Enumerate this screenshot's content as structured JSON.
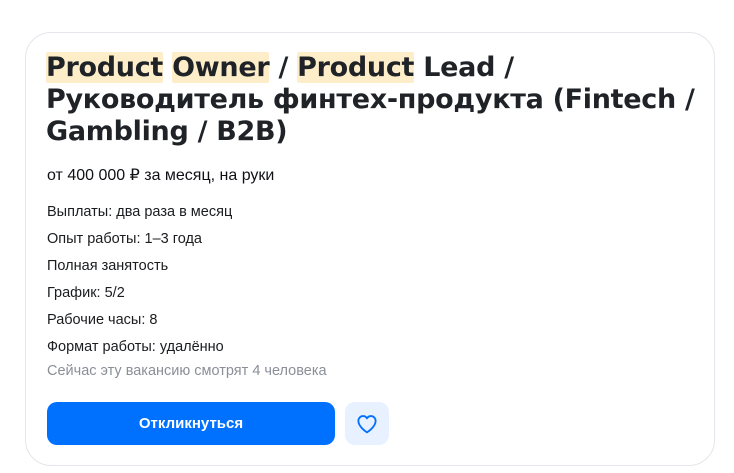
{
  "vacancy": {
    "title_parts": [
      {
        "text": "Product",
        "highlight": true
      },
      {
        "text": " ",
        "highlight": false
      },
      {
        "text": "Owner",
        "highlight": true
      },
      {
        "text": " / ",
        "highlight": false
      },
      {
        "text": "Product",
        "highlight": true
      },
      {
        "text": " Lead / Руководитель финтех-продукта (Fintech / Gambling / B2B)",
        "highlight": false
      }
    ],
    "salary": "от 400 000 ₽ за месяц, на руки",
    "details": [
      "Выплаты: два раза в месяц",
      "Опыт работы: 1–3 года",
      "Полная занятость",
      "График: 5/2",
      "Рабочие часы: 8",
      "Формат работы: удалённо"
    ],
    "viewers": "Сейчас эту вакансию смотрят 4 человека"
  },
  "actions": {
    "apply_label": "Откликнуться",
    "favorite_icon": "heart-outline-icon"
  },
  "colors": {
    "accent": "#0070ff",
    "highlight": "#fdedc8",
    "favorite_bg": "#e8f1ff",
    "muted_text": "#8a8f98",
    "card_border": "#e3e6ea"
  }
}
